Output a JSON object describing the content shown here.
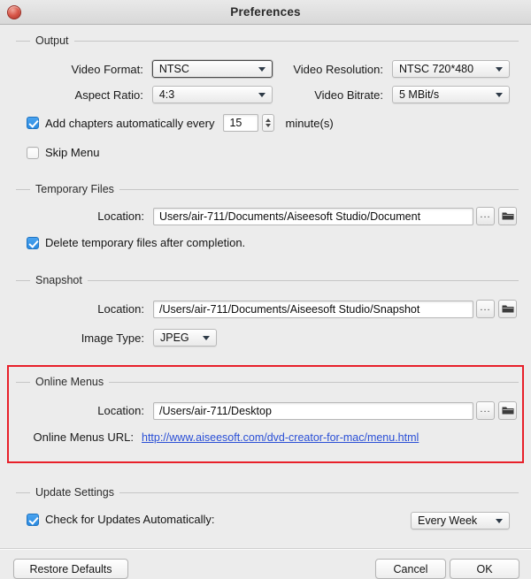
{
  "window": {
    "title": "Preferences",
    "close_icon": "close-circle-icon"
  },
  "sections": {
    "output": {
      "title": "Output",
      "video_format": {
        "label": "Video Format:",
        "value": "NTSC"
      },
      "video_resolution": {
        "label": "Video Resolution:",
        "value": "NTSC 720*480"
      },
      "aspect_ratio": {
        "label": "Aspect Ratio:",
        "value": "4:3"
      },
      "video_bitrate": {
        "label": "Video Bitrate:",
        "value": "5 MBit/s"
      },
      "add_chapters": {
        "label": "Add chapters automatically every",
        "checked": true,
        "value": "15",
        "unit": "minute(s)"
      },
      "skip_menu": {
        "label": "Skip Menu",
        "checked": false
      }
    },
    "temporary_files": {
      "title": "Temporary Files",
      "location": {
        "label": "Location:",
        "value": "Users/air-711/Documents/Aiseesoft Studio/Document"
      },
      "browse_label": "...",
      "folder_icon": "folder-icon",
      "delete_temp": {
        "label": "Delete temporary files after completion.",
        "checked": true
      }
    },
    "snapshot": {
      "title": "Snapshot",
      "location": {
        "label": "Location:",
        "value": "/Users/air-711/Documents/Aiseesoft Studio/Snapshot"
      },
      "browse_label": "...",
      "folder_icon": "folder-icon",
      "image_type": {
        "label": "Image Type:",
        "value": "JPEG"
      }
    },
    "online_menus": {
      "title": "Online Menus",
      "highlighted": true,
      "highlight_color": "#e8202a",
      "location": {
        "label": "Location:",
        "value": "/Users/air-711/Desktop"
      },
      "browse_label": "...",
      "folder_icon": "folder-icon",
      "url": {
        "label": "Online Menus URL:",
        "value": "http://www.aiseesoft.com/dvd-creator-for-mac/menu.html",
        "color": "#2a4fd6"
      }
    },
    "update_settings": {
      "title": "Update Settings",
      "check_updates": {
        "label": "Check for Updates Automatically:",
        "checked": true
      },
      "frequency": {
        "value": "Every Week"
      }
    }
  },
  "footer": {
    "restore_defaults": "Restore Defaults",
    "cancel": "Cancel",
    "ok": "OK"
  }
}
